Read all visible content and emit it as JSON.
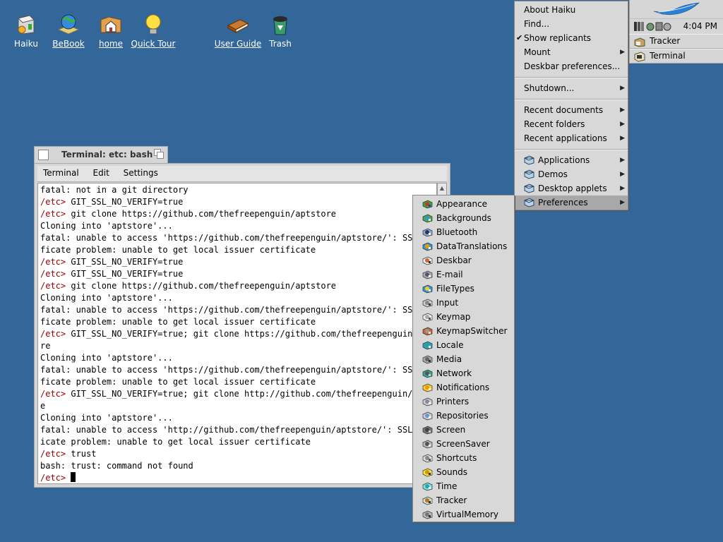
{
  "desktop": {
    "icons": [
      {
        "label": "Haiku",
        "icon": "haiku-disk-icon"
      },
      {
        "label": "BeBook",
        "icon": "globe-book-icon"
      },
      {
        "label": "home",
        "icon": "home-folder-icon"
      },
      {
        "label": "Quick Tour",
        "icon": "lightbulb-icon"
      },
      {
        "label": "User Guide",
        "icon": "book-icon"
      },
      {
        "label": "Trash",
        "icon": "trash-icon"
      }
    ],
    "background_color": "#336699"
  },
  "terminal": {
    "title": "Terminal: etc: bash",
    "menu": [
      "Terminal",
      "Edit",
      "Settings"
    ],
    "prompt": "/etc>",
    "prompt_color": "#a00000",
    "lines": [
      {
        "prompt": "",
        "text": "fatal: not in a git directory"
      },
      {
        "prompt": "/etc>",
        "text": " GIT_SSL_NO_VERIFY=true"
      },
      {
        "prompt": "/etc>",
        "text": " git clone https://github.com/thefreepenguin/aptstore"
      },
      {
        "prompt": "",
        "text": "Cloning into 'aptstore'..."
      },
      {
        "prompt": "",
        "text": "fatal: unable to access 'https://github.com/thefreepenguin/aptstore/': SSL certi"
      },
      {
        "prompt": "",
        "text": "ficate problem: unable to get local issuer certificate"
      },
      {
        "prompt": "/etc>",
        "text": " GIT_SSL_NO_VERIFY=true"
      },
      {
        "prompt": "/etc>",
        "text": " GIT_SSL_NO_VERIFY=true"
      },
      {
        "prompt": "/etc>",
        "text": " git clone https://github.com/thefreepenguin/aptstore"
      },
      {
        "prompt": "",
        "text": "Cloning into 'aptstore'..."
      },
      {
        "prompt": "",
        "text": "fatal: unable to access 'https://github.com/thefreepenguin/aptstore/': SSL certi"
      },
      {
        "prompt": "",
        "text": "ficate problem: unable to get local issuer certificate"
      },
      {
        "prompt": "/etc>",
        "text": " GIT_SSL_NO_VERIFY=true; git clone https://github.com/thefreepenguin/aptsto"
      },
      {
        "prompt": "",
        "text": "re"
      },
      {
        "prompt": "",
        "text": "Cloning into 'aptstore'..."
      },
      {
        "prompt": "",
        "text": "fatal: unable to access 'https://github.com/thefreepenguin/aptstore/': SSL certi"
      },
      {
        "prompt": "",
        "text": "ficate problem: unable to get local issuer certificate"
      },
      {
        "prompt": "/etc>",
        "text": " GIT_SSL_NO_VERIFY=true; git clone http://github.com/thefreepenguin/aptstor"
      },
      {
        "prompt": "",
        "text": "e"
      },
      {
        "prompt": "",
        "text": "Cloning into 'aptstore'..."
      },
      {
        "prompt": "",
        "text": "fatal: unable to access 'http://github.com/thefreepenguin/aptstore/': SSL certif"
      },
      {
        "prompt": "",
        "text": "icate problem: unable to get local issuer certificate"
      },
      {
        "prompt": "/etc>",
        "text": " trust"
      },
      {
        "prompt": "",
        "text": "bash: trust: command not found"
      },
      {
        "prompt": "/etc>",
        "text": " "
      }
    ]
  },
  "deskbar": {
    "clock": "4:04 PM",
    "apps": [
      {
        "label": "Tracker",
        "icon": "tracker-icon"
      },
      {
        "label": "Terminal",
        "icon": "terminal-icon"
      }
    ]
  },
  "main_menu": {
    "items": [
      {
        "label": "About Haiku",
        "type": "item"
      },
      {
        "label": "Find...",
        "type": "item"
      },
      {
        "label": "Show replicants",
        "type": "item",
        "checked": true
      },
      {
        "label": "Mount",
        "type": "submenu"
      },
      {
        "label": "Deskbar preferences...",
        "type": "item"
      },
      {
        "type": "separator"
      },
      {
        "label": "Shutdown...",
        "type": "submenu"
      },
      {
        "type": "separator"
      },
      {
        "label": "Recent documents",
        "type": "submenu"
      },
      {
        "label": "Recent folders",
        "type": "submenu"
      },
      {
        "label": "Recent applications",
        "type": "submenu"
      },
      {
        "type": "separator"
      },
      {
        "label": "Applications",
        "type": "submenu",
        "icon": "folder-icon"
      },
      {
        "label": "Demos",
        "type": "submenu",
        "icon": "folder-icon"
      },
      {
        "label": "Desktop applets",
        "type": "submenu",
        "icon": "folder-icon"
      },
      {
        "label": "Preferences",
        "type": "submenu",
        "icon": "folder-icon",
        "selected": true
      }
    ]
  },
  "preferences_menu": {
    "items": [
      {
        "label": "Appearance",
        "icon": "appearance-icon"
      },
      {
        "label": "Backgrounds",
        "icon": "backgrounds-icon"
      },
      {
        "label": "Bluetooth",
        "icon": "bluetooth-icon"
      },
      {
        "label": "DataTranslations",
        "icon": "datatranslations-icon"
      },
      {
        "label": "Deskbar",
        "icon": "deskbar-icon"
      },
      {
        "label": "E-mail",
        "icon": "email-icon"
      },
      {
        "label": "FileTypes",
        "icon": "filetypes-icon"
      },
      {
        "label": "Input",
        "icon": "input-icon"
      },
      {
        "label": "Keymap",
        "icon": "keymap-icon"
      },
      {
        "label": "KeymapSwitcher",
        "icon": "keymapswitcher-icon"
      },
      {
        "label": "Locale",
        "icon": "locale-icon"
      },
      {
        "label": "Media",
        "icon": "media-icon"
      },
      {
        "label": "Network",
        "icon": "network-icon"
      },
      {
        "label": "Notifications",
        "icon": "notifications-icon"
      },
      {
        "label": "Printers",
        "icon": "printers-icon"
      },
      {
        "label": "Repositories",
        "icon": "repositories-icon"
      },
      {
        "label": "Screen",
        "icon": "screen-icon"
      },
      {
        "label": "ScreenSaver",
        "icon": "screensaver-icon"
      },
      {
        "label": "Shortcuts",
        "icon": "shortcuts-icon"
      },
      {
        "label": "Sounds",
        "icon": "sounds-icon"
      },
      {
        "label": "Time",
        "icon": "time-icon"
      },
      {
        "label": "Tracker",
        "icon": "tracker-icon"
      },
      {
        "label": "VirtualMemory",
        "icon": "virtualmemory-icon"
      }
    ]
  }
}
